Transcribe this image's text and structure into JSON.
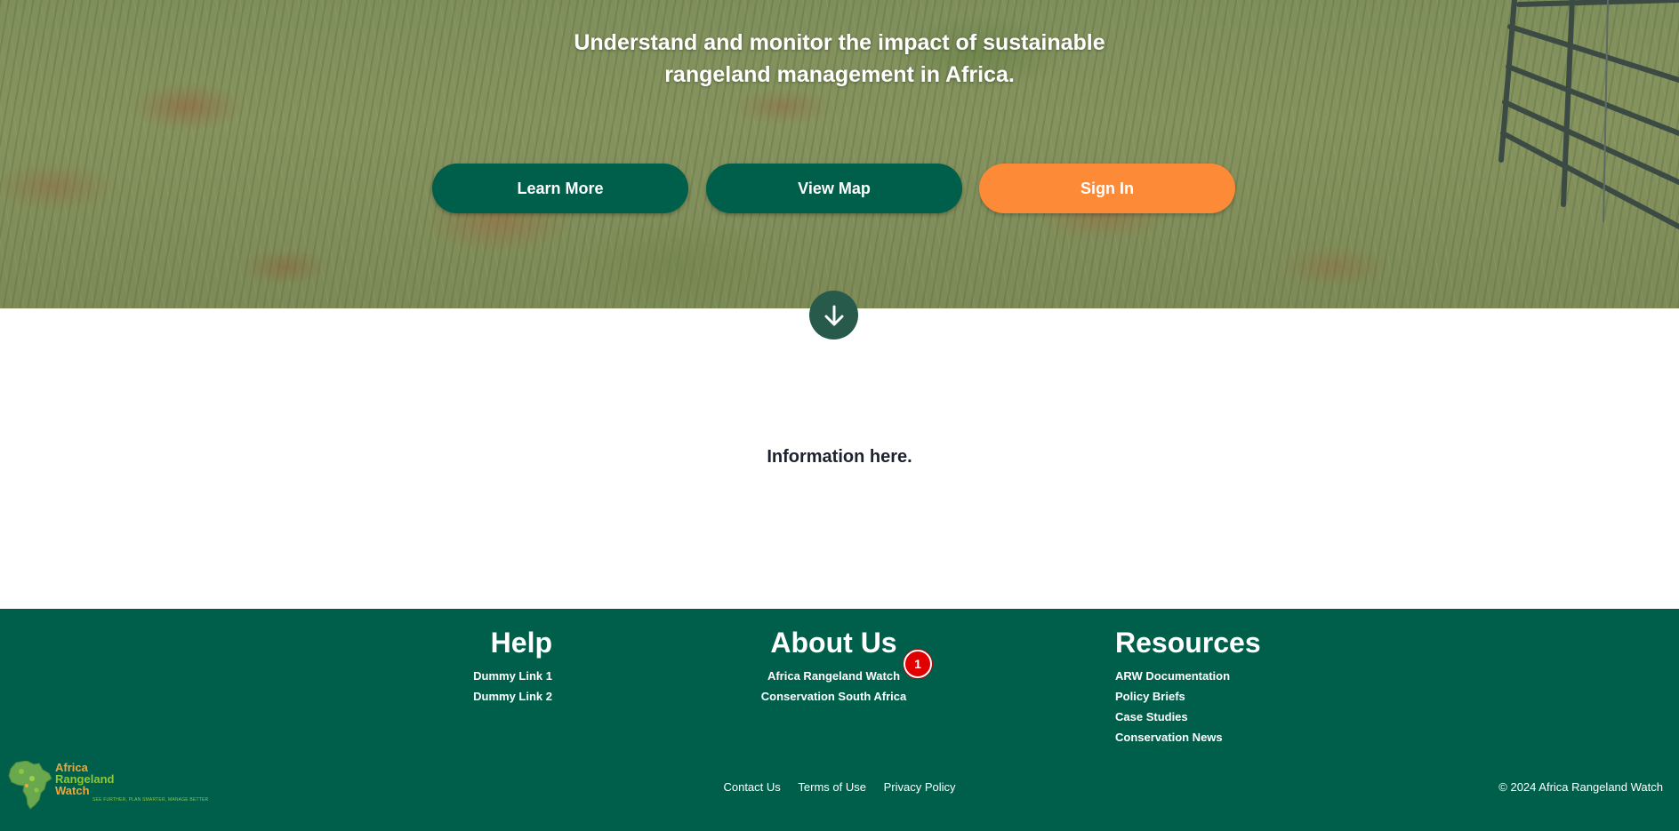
{
  "hero": {
    "headline_line1": "Understand and monitor the impact of sustainable",
    "headline_line2": "rangeland management in Africa.",
    "buttons": {
      "learn_more": "Learn More",
      "view_map": "View Map",
      "sign_in": "Sign In"
    }
  },
  "main": {
    "info_text": "Information here."
  },
  "footer": {
    "help": {
      "title": "Help",
      "links": [
        "Dummy Link 1",
        "Dummy Link 2"
      ]
    },
    "about": {
      "title": "About Us",
      "links": [
        "Africa Rangeland Watch",
        "Conservation South Africa"
      ],
      "badge_count": "1"
    },
    "resources": {
      "title": "Resources",
      "links": [
        "ARW Documentation",
        "Policy Briefs",
        "Case Studies",
        "Conservation News"
      ]
    },
    "logo": {
      "line1": "Africa",
      "line2": "Rangeland",
      "line3": "Watch",
      "tagline": "SEE FURTHER, PLAN SMARTER, MANAGE BETTER"
    },
    "legal_links": [
      "Contact Us",
      "Terms of Use",
      "Privacy Policy"
    ],
    "copyright": "© 2024 Africa Rangeland Watch"
  },
  "colors": {
    "primary_green": "#005f4b",
    "accent_orange": "#fd8a37",
    "scroll_button": "#275a4a",
    "badge_red": "#e00000"
  },
  "icons": {
    "scroll_button": "arrow-down-icon",
    "logo": "africa-map-icon"
  }
}
